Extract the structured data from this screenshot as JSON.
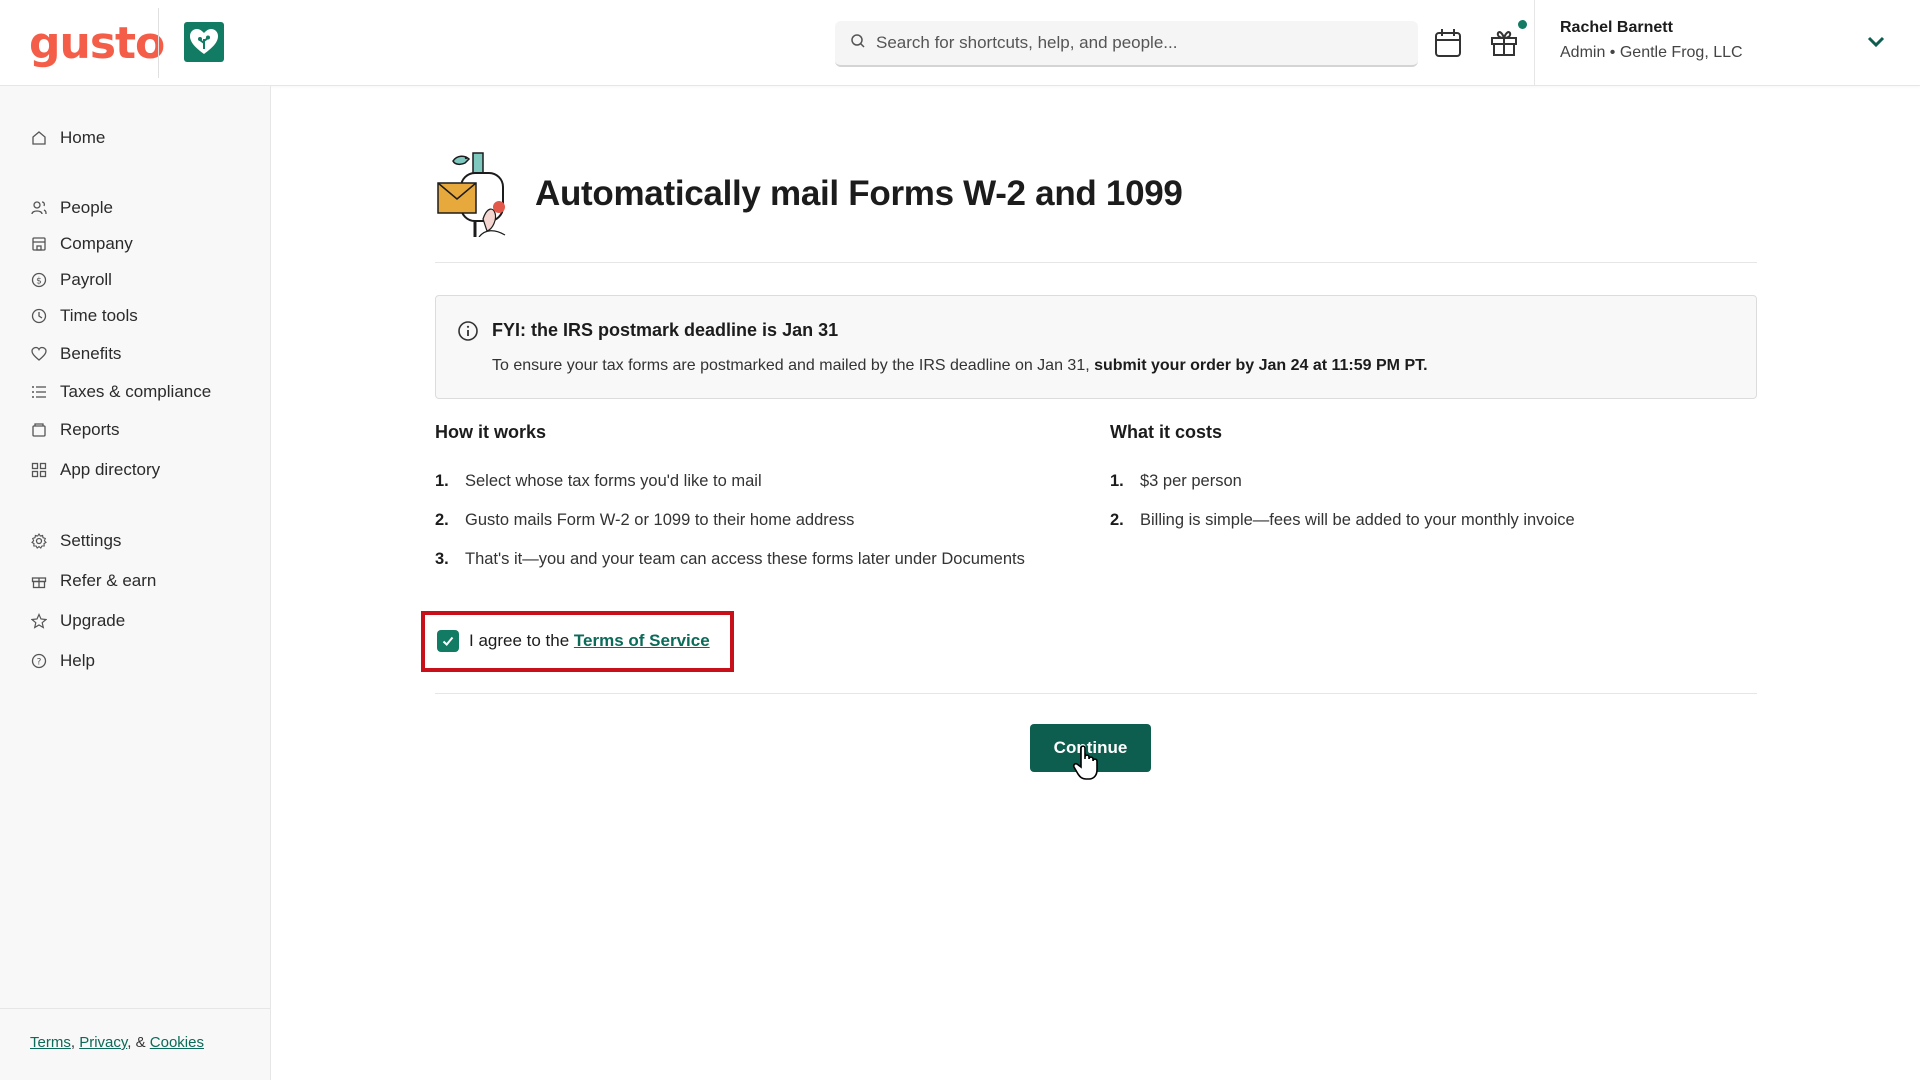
{
  "brand": {
    "logo_text": "gusto",
    "accent": "#f45d48",
    "primary": "#127b63",
    "button": "#0d5e4f",
    "highlight": "#c8101a"
  },
  "header": {
    "search_placeholder": "Search for shortcuts, help, and people...",
    "user_name": "Rachel Barnett",
    "user_role": "Admin • Gentle Frog, LLC",
    "icons": [
      "search-icon",
      "calendar-icon",
      "gift-icon",
      "chevron-down-icon"
    ]
  },
  "sidebar": {
    "items": [
      {
        "label": "Home",
        "icon": "home-icon"
      },
      {
        "label": "People",
        "icon": "people-icon"
      },
      {
        "label": "Company",
        "icon": "company-icon"
      },
      {
        "label": "Payroll",
        "icon": "payroll-icon"
      },
      {
        "label": "Time tools",
        "icon": "clock-icon"
      },
      {
        "label": "Benefits",
        "icon": "heart-icon"
      },
      {
        "label": "Taxes & compliance",
        "icon": "list-icon"
      },
      {
        "label": "Reports",
        "icon": "reports-icon"
      },
      {
        "label": "App directory",
        "icon": "apps-icon"
      },
      {
        "label": "Settings",
        "icon": "gear-icon"
      },
      {
        "label": "Refer & earn",
        "icon": "gift-icon"
      },
      {
        "label": "Upgrade",
        "icon": "star-icon"
      },
      {
        "label": "Help",
        "icon": "help-icon"
      }
    ],
    "footer": {
      "terms": "Terms",
      "privacy": "Privacy",
      "sep1": ", ",
      "sep2": ", & ",
      "cookies": "Cookies"
    }
  },
  "main": {
    "title": "Automatically mail Forms W-2 and 1099",
    "notice": {
      "title": "FYI: the IRS postmark deadline is Jan 31",
      "body": "To ensure your tax forms are postmarked and mailed by the IRS deadline on Jan 31, ",
      "body_bold": "submit your order by Jan 24 at 11:59 PM PT."
    },
    "how_it_works": {
      "heading": "How it works",
      "items": [
        {
          "num": "1.",
          "text": "Select whose tax forms you'd like to mail"
        },
        {
          "num": "2.",
          "text": "Gusto mails Form W-2 or 1099 to their home address"
        },
        {
          "num": "3.",
          "text": "That's it—you and your team can access these forms later under Documents"
        }
      ]
    },
    "what_it_costs": {
      "heading": "What it costs",
      "items": [
        {
          "num": "1.",
          "text": "$3 per person"
        },
        {
          "num": "2.",
          "text": "Billing is simple—fees will be added to your monthly invoice"
        }
      ]
    },
    "agree": {
      "prefix": "I agree to the ",
      "link": "Terms of Service",
      "checked": true
    },
    "continue_label": "Continue"
  }
}
